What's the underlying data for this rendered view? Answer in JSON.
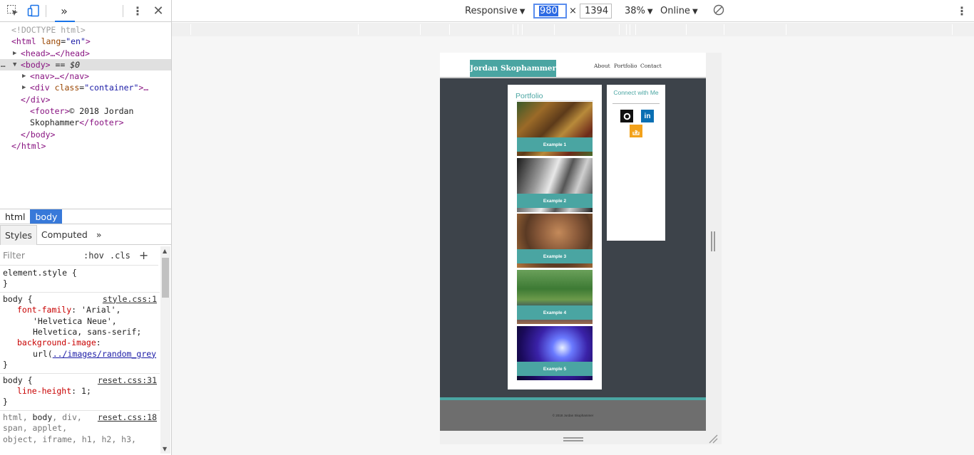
{
  "devtools": {
    "toolbar": {
      "inspect_icon": "element-picker-icon",
      "device_icon": "device-toggle-icon",
      "more_panels": "»",
      "kebab": "⋮",
      "close": "✕"
    },
    "dom": {
      "doctype": "<!DOCTYPE html>",
      "html_open_tag": "<html",
      "html_attr_name": "lang",
      "html_attr_value": "\"en\"",
      "html_open_close": ">",
      "head": "<head>…</head>",
      "body_open": "<body>",
      "body_eq": "== $0",
      "nav": "<nav>…</nav>",
      "div_tag": "<div",
      "div_attr_name": "class",
      "div_attr_value": "\"container\"",
      "div_rest": ">…",
      "div_close": "</div>",
      "footer_open": "<footer>",
      "footer_text_1": "© 2018 Jordan",
      "footer_text_2": "Skophammer",
      "footer_close": "</footer>",
      "body_close": "</body>",
      "html_close": "</html>",
      "ellipsis": "…"
    },
    "breadcrumbs": [
      "html",
      "body"
    ],
    "style_tabs": {
      "styles": "Styles",
      "computed": "Computed",
      "more": "»"
    },
    "filter": {
      "placeholder": "Filter",
      "hov": ":hov",
      "cls": ".cls",
      "add": "+"
    },
    "rules": {
      "r1_selector": "element.style {",
      "r1_close": "}",
      "r2_selector": "body {",
      "r2_source": "style.css:1",
      "r2_prop1": "font-family",
      "r2_val1a": "'Arial',",
      "r2_val1b": "'Helvetica Neue',",
      "r2_val1c": "Helvetica, sans-serif;",
      "r2_prop2": "background-image",
      "r2_val2_prefix": "url(",
      "r2_val2_link": "../images/random_grey",
      "r2_close": "}",
      "r3_selector": "body {",
      "r3_source": "reset.css:31",
      "r3_prop": "line-height",
      "r3_val": "1;",
      "r3_close": "}",
      "r4_sel1": "html, ",
      "r4_sel2": "body",
      "r4_sel3": ", div,",
      "r4_source": "reset.css:18",
      "r4_line2": "span, applet,",
      "r4_line3": "object, iframe, h1, h2, h3,"
    }
  },
  "device_toolbar": {
    "device": "Responsive",
    "width": "980",
    "times": "×",
    "height": "1394",
    "zoom": "38%",
    "network": "Online",
    "rotate_icon": "rotate-icon",
    "kebab": "⋮"
  },
  "site": {
    "logo": "Jordan Skophammer",
    "nav_links": [
      "About",
      "Portfolio",
      "Contact"
    ],
    "portfolio_title": "Portfolio",
    "examples": [
      "Example 1",
      "Example 2",
      "Example 3",
      "Example 4",
      "Example 5"
    ],
    "connect_title": "Connect with Me",
    "social": {
      "github": "github-icon",
      "linkedin": "in",
      "stackoverflow": "stackoverflow-icon"
    },
    "footer": "© 2018 Jordan Skophammer"
  }
}
